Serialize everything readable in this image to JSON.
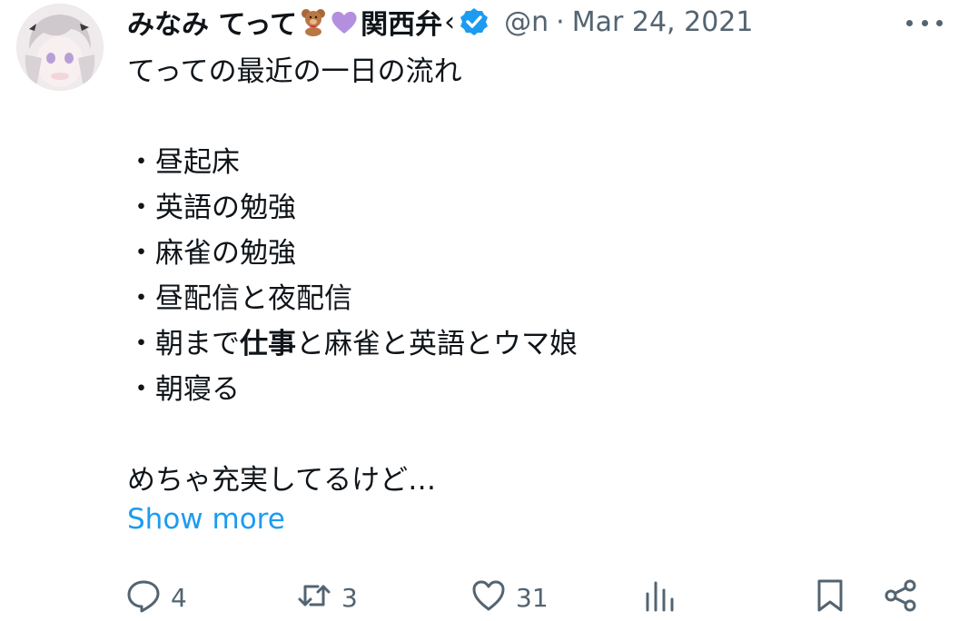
{
  "tweet": {
    "display_name": "みなみ てって",
    "name_tail": "関西弁",
    "name_truncation": "‹",
    "handle": "@n",
    "dot": "·",
    "date": "Mar 24, 2021",
    "lines": [
      "てっての最近の一日の流れ",
      "",
      "・昼起床",
      "・英語の勉強",
      "・麻雀の勉強",
      "・昼配信と夜配信"
    ],
    "line6_a": "・朝まで",
    "line6_bold": "仕事",
    "line6_b": "と麻雀と英語とウマ娘",
    "line7": "・朝寝る",
    "line9": "めちゃ充実してるけど…",
    "show_more": "Show more"
  },
  "actions": {
    "replies": "4",
    "retweets": "3",
    "likes": "31"
  },
  "icons": [
    "avatar",
    "teddy-bear-icon",
    "purple-heart-icon",
    "verified-badge-icon",
    "more-icon",
    "reply-icon",
    "retweet-icon",
    "like-icon",
    "views-icon",
    "bookmark-icon",
    "share-icon"
  ],
  "colors": {
    "text": "#0f1419",
    "secondary": "#536471",
    "link": "#1d9bf0",
    "verified": "#1d9bf0",
    "heart_emoji": "#b48fe0"
  }
}
